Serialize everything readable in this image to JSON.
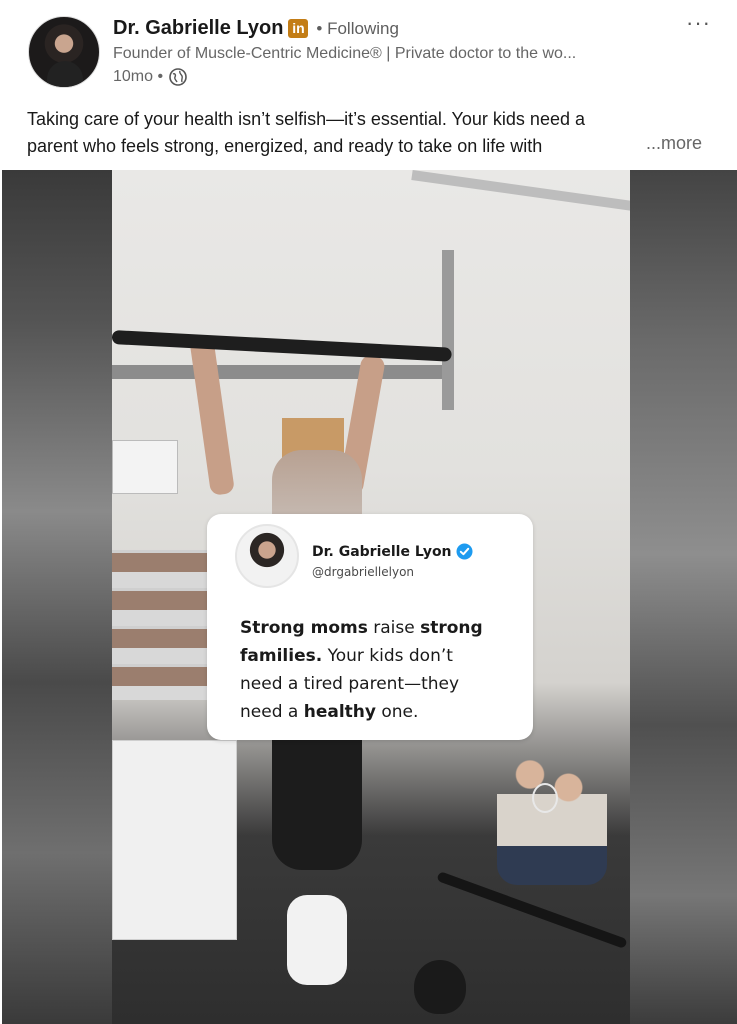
{
  "post": {
    "author": {
      "name": "Dr. Gabrielle Lyon",
      "badge": "in",
      "follow_status": "• Following",
      "headline": "Founder of Muscle-Centric Medicine® | Private doctor to the wo...",
      "time": "10mo •"
    },
    "menu_icon": "ellipsis-icon",
    "text": {
      "line1": "Taking care of your health isn’t selfish—it’s essential. Your kids need a",
      "line2": "parent who feels strong, energized, and ready to take on life with",
      "more_label": "...more"
    },
    "media": {
      "card": {
        "name": "Dr. Gabrielle Lyon",
        "handle": "@drgabriellelyon",
        "verified_icon": "verified-check-icon",
        "quote": {
          "l1_bold_a": "Strong moms",
          "l1_plain": " raise ",
          "l1_bold_b": "strong",
          "l2_bold": "families.",
          "l2_plain": " Your kids don’t",
          "l3": "need a tired parent—they",
          "l4_plain_a": "need a ",
          "l4_bold": "healthy",
          "l4_plain_b": " one."
        }
      }
    }
  },
  "colors": {
    "badge": "#c37d16",
    "text_primary": "#191919",
    "text_secondary": "#666666",
    "verified": "#1d9bf0"
  }
}
